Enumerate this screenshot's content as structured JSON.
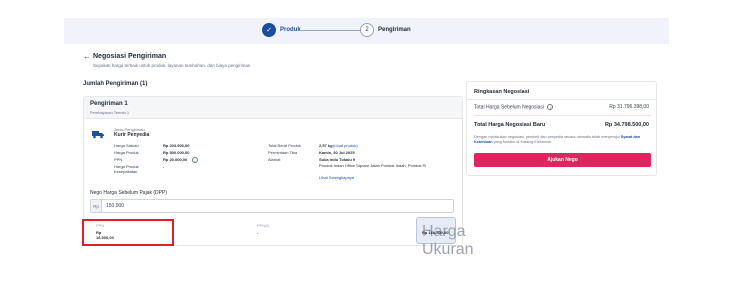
{
  "stepper": {
    "steps": [
      {
        "label": "Produk",
        "icon": "✓"
      },
      {
        "label": "Pengiriman",
        "number": "2"
      }
    ]
  },
  "header": {
    "title": "Negosiasi Pengiriman",
    "subtitle": "Sepakati harga terbaik untuk produk, layanan tambahan, dan biaya pengiriman"
  },
  "section_title": "Jumlah Pengiriman (1)",
  "shipment": {
    "name": "Pengiriman 1",
    "order": "Pembayaran Termin 1",
    "type_label": "Jenis Pengiriman",
    "type_value": "Kurir Penyedia",
    "col1": [
      {
        "label": "Harga Satuan",
        "value": "Rp 203.900,00"
      },
      {
        "label": "Harga Produk",
        "value": "Rp 500.000,00"
      },
      {
        "label": "PPN",
        "value": "Rp 20.000,00"
      },
      {
        "label": "Harga Produk Kesepakatan",
        "value": "-"
      }
    ],
    "col2": [
      {
        "label": "Total Berat Produk",
        "value": "2,57 kg",
        "link": "(Lihat produk)"
      },
      {
        "label": "Permintaan Tiba",
        "value": "Kamis, 30 Jul 2025"
      },
      {
        "label": "Alamat",
        "value": "Suka Indo Tokalu 9"
      },
      {
        "label": "",
        "value": "Pondok Indah Office Square Jalan Pondok Indah, Pondok Pi"
      },
      {
        "label": "",
        "value": "",
        "link": "Lihat Selengkapnya"
      }
    ]
  },
  "nego": {
    "label": "Nego Harga Sebelum Pajak (DPP)",
    "prefix": "Rp",
    "value": "150.000"
  },
  "summary_row": {
    "ppn_label": "PPN",
    "ppn_value": "Rp 16.500,00",
    "pph_label": "PPh(0)",
    "pph_value": "-",
    "total_label": "Harga Ukuran",
    "total_value": "Rp 166.500,00"
  },
  "summary_card": {
    "title": "Ringkasan Negosiasi",
    "before_label": "Total Harga Sebelum Negosiasi",
    "before_value": "Rp 31.796.398,00",
    "after_label": "Total Harga Negosiasi Baru",
    "after_value": "Rp 34.798.500,00",
    "note_text": "Dengan melakukan negosiasi, pembeli dan penyedia secara otomatis telah menyetujui",
    "note_link": "Syarat dan Ketentuan",
    "note_tail": "yang berlaku di Katalog Elektronik.",
    "button_label": "Ajukan Nego"
  },
  "colors": {
    "accent": "#1a4fa0",
    "button": "#e0245e",
    "highlight": "#e11d2a"
  }
}
